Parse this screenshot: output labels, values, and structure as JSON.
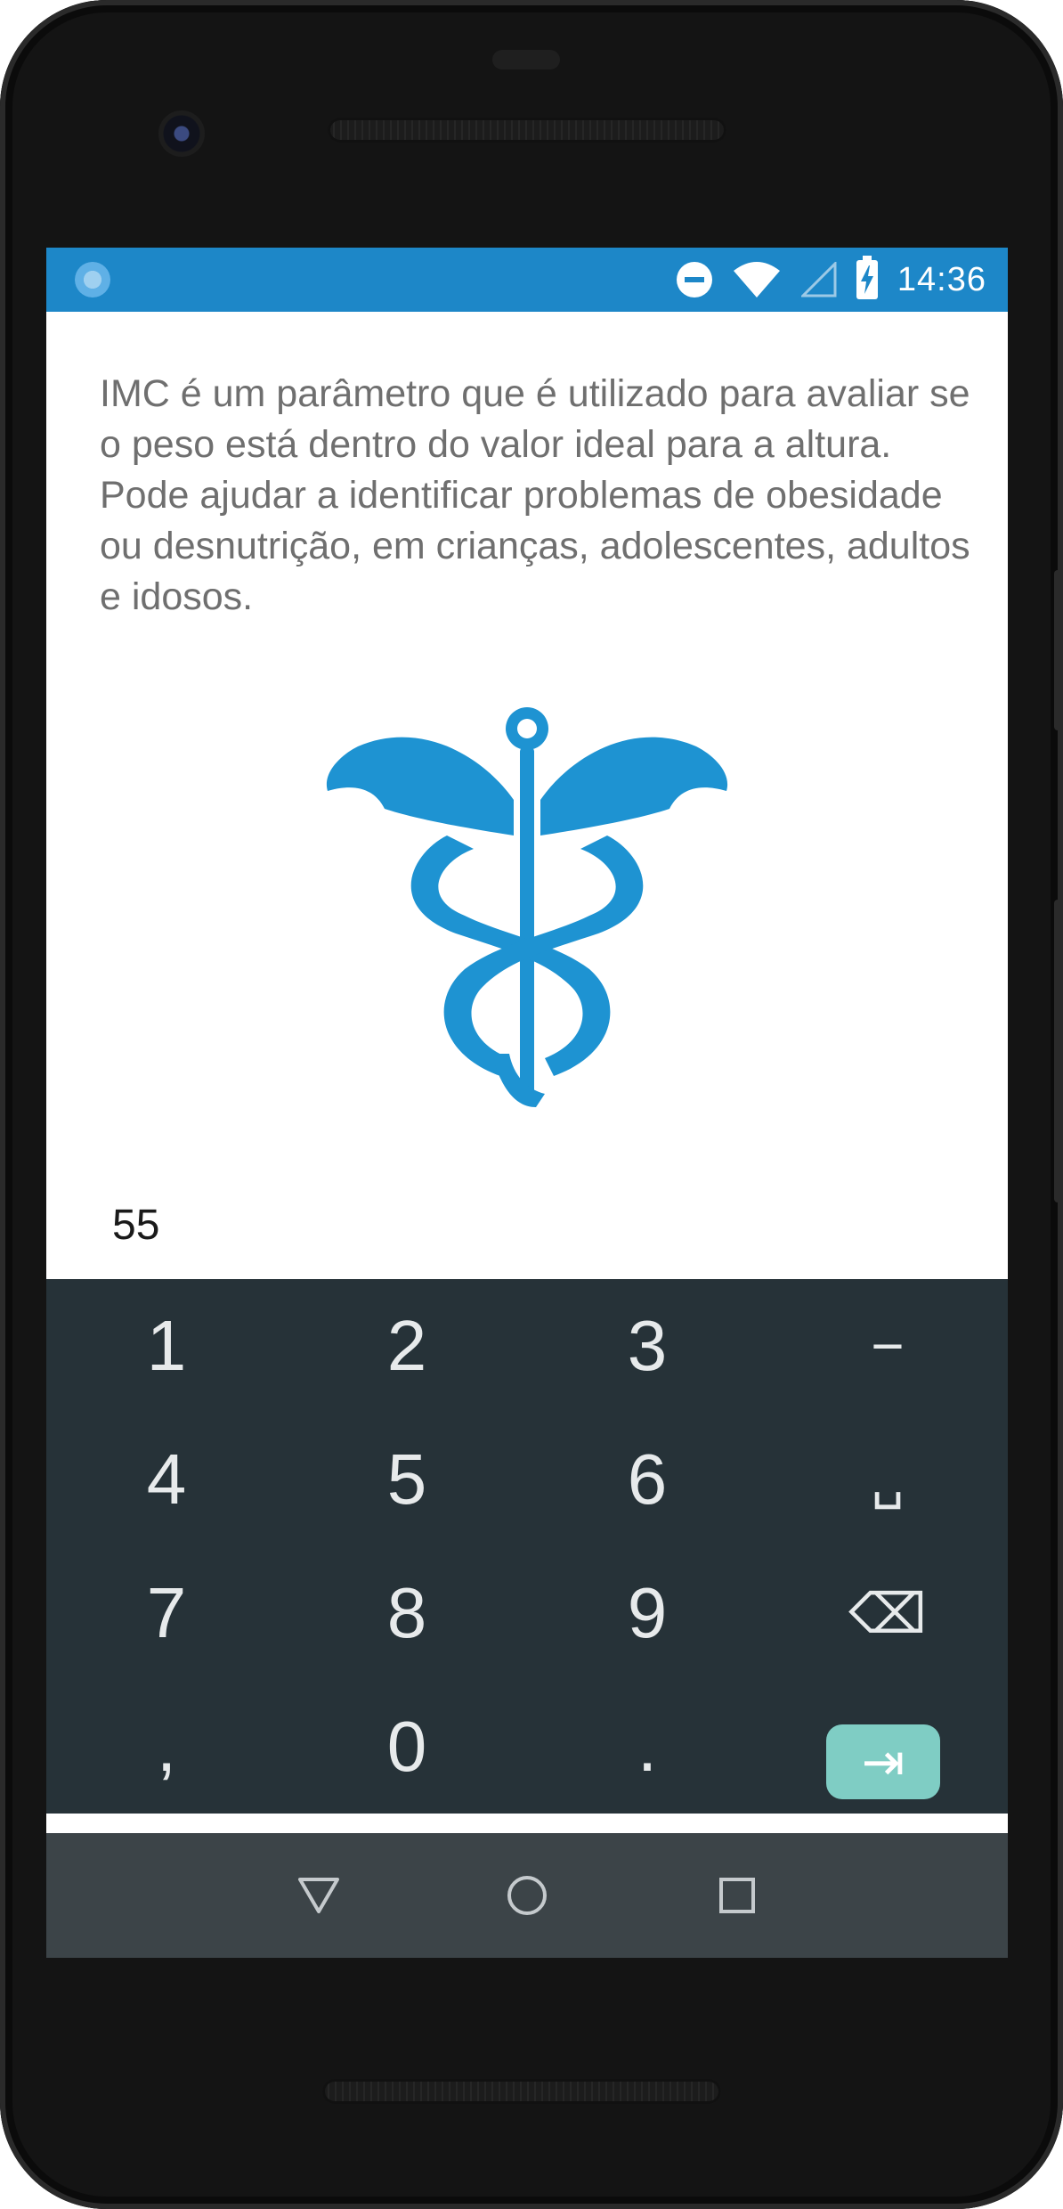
{
  "status_bar": {
    "time": "14:36",
    "icons": [
      "app-notification-icon",
      "do-not-disturb-icon",
      "wifi-icon",
      "cellular-signal-icon",
      "battery-charging-icon"
    ]
  },
  "content": {
    "description": "IMC é um parâmetro que é utilizado para avaliar se o peso está dentro do valor ideal para a altura. Pode ajudar a identificar problemas de obesidade ou desnutrição, em crianças, adolescentes, adultos e idosos.",
    "emblem_icon": "caduceus-icon",
    "weight_value": "55"
  },
  "keyboard": {
    "rows": [
      [
        "1",
        "2",
        "3",
        "−"
      ],
      [
        "4",
        "5",
        "6",
        "␣"
      ],
      [
        "7",
        "8",
        "9",
        "⌫"
      ],
      [
        ",",
        "0",
        ".",
        "⇥"
      ]
    ]
  },
  "navigation": {
    "buttons": [
      "back-icon",
      "home-icon",
      "recents-icon"
    ]
  },
  "colors": {
    "accent": "#1d87c8",
    "emblem": "#1e93d2",
    "keyboard_bg": "#263238",
    "key_action": "#7fcdc4",
    "nav_bg": "#3c4448"
  }
}
